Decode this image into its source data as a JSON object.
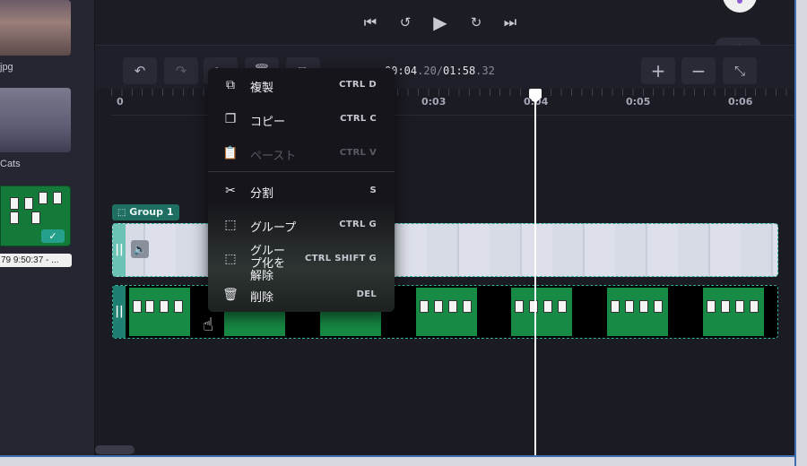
{
  "media": {
    "items": [
      {
        "label": "jpg"
      },
      {
        "label": "Cats"
      },
      {
        "label": "79 9:50:37 - ..."
      }
    ],
    "check_icon": "checkmark-icon"
  },
  "player": {
    "controls": [
      "skip-back-icon",
      "rewind-5-icon",
      "play-icon",
      "forward-5-icon",
      "skip-forward-icon"
    ],
    "rewind_label": "5",
    "forward_label": "5"
  },
  "toolbar": {
    "timecode_current": "00:04",
    "timecode_current_frac": ".20",
    "separator": "/",
    "timecode_total": "01:58",
    "timecode_total_frac": ".32"
  },
  "ruler": {
    "labels": [
      "0",
      "0:03",
      "0:04",
      "0:05",
      "0:06"
    ]
  },
  "timeline": {
    "group_label": "Group 1"
  },
  "context_menu": {
    "items": [
      {
        "label": "複製",
        "shortcut": "CTRL   D",
        "icon": "duplicate-icon",
        "enabled": true
      },
      {
        "label": "コピー",
        "shortcut": "CTRL   C",
        "icon": "copy-icon",
        "enabled": true
      },
      {
        "label": "ペースト",
        "shortcut": "CTRL   V",
        "icon": "paste-icon",
        "enabled": false
      },
      {
        "label": "分割",
        "shortcut": "S",
        "icon": "scissors-icon",
        "enabled": true
      },
      {
        "label": "グループ",
        "shortcut": "CTRL   G",
        "icon": "group-icon",
        "enabled": true
      },
      {
        "label": "グループ化を解除",
        "shortcut": "CTRL  SHIFT   G",
        "icon": "ungroup-icon",
        "enabled": true
      },
      {
        "label": "削除",
        "shortcut": "DEL",
        "icon": "trash-icon",
        "enabled": true
      }
    ]
  },
  "colors": {
    "accent": "#33b3a0",
    "group_tag": "#1f6e62",
    "background": "#1e1e28"
  }
}
